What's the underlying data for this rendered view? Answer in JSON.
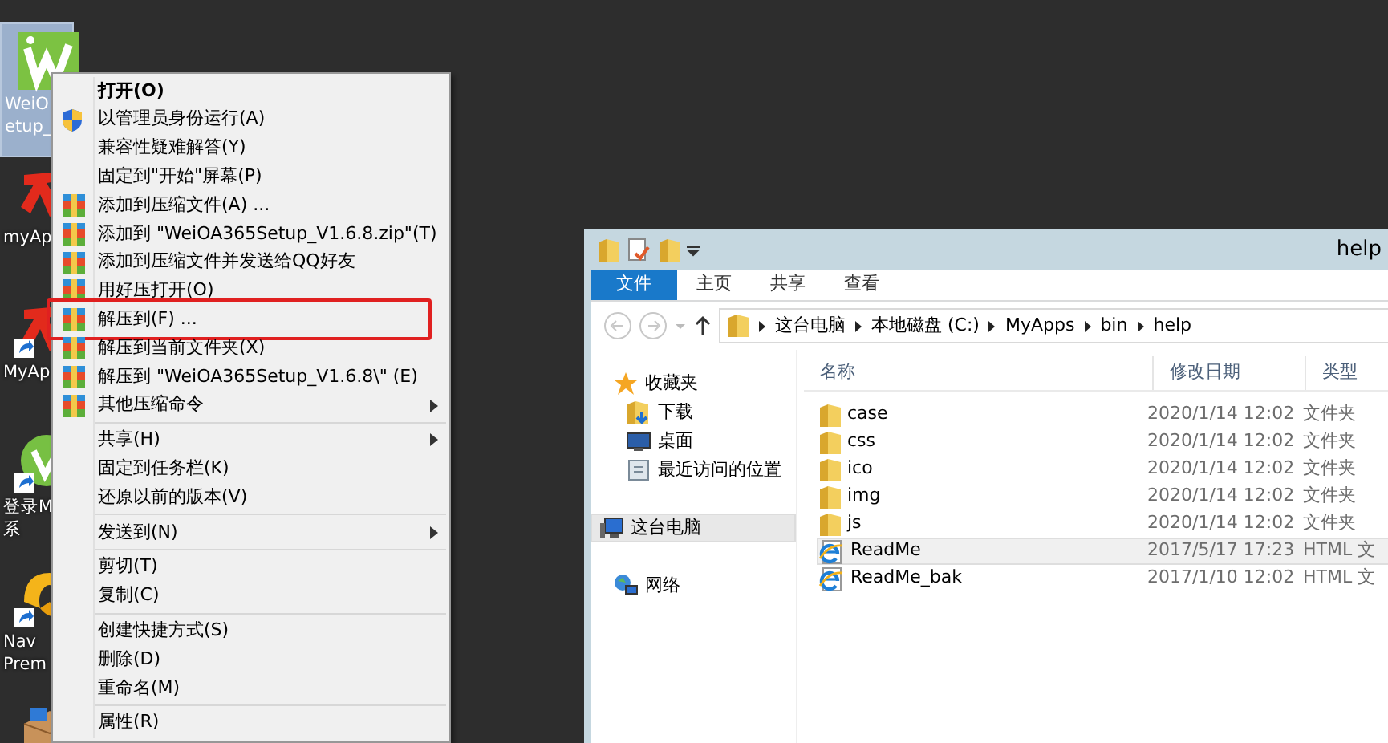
{
  "desktop_icons": [
    {
      "kind": "weioa",
      "labels": [
        "WeiO",
        "etup_"
      ],
      "selected": true,
      "shortcut": false
    },
    {
      "kind": "tianyi",
      "labels": [
        "myAp"
      ],
      "selected": false,
      "shortcut": false
    },
    {
      "kind": "tianyi",
      "labels": [
        "MyAp"
      ],
      "selected": false,
      "shortcut": true
    },
    {
      "kind": "login",
      "labels": [
        "登录M",
        "系"
      ],
      "selected": false,
      "shortcut": true
    },
    {
      "kind": "navicat",
      "labels": [
        "Nav",
        "Prem"
      ],
      "selected": false,
      "shortcut": true
    },
    {
      "kind": "package",
      "selected": false
    }
  ],
  "context_menu": {
    "items": [
      {
        "kind": "plain",
        "label": "打开(O)",
        "default": true,
        "submenu": false,
        "annotated": false
      },
      {
        "kind": "shield",
        "label": "以管理员身份运行(A)",
        "default": false,
        "submenu": false,
        "annotated": false
      },
      {
        "kind": "plain",
        "label": "兼容性疑难解答(Y)",
        "default": false,
        "submenu": false,
        "annotated": false
      },
      {
        "kind": "plain",
        "label": "固定到\"开始\"屏幕(P)",
        "default": false,
        "submenu": false,
        "annotated": false
      },
      {
        "kind": "archive",
        "label": "添加到压缩文件(A) ...",
        "default": false,
        "submenu": false,
        "annotated": false
      },
      {
        "kind": "archive",
        "label": "添加到 \"WeiOA365Setup_V1.6.8.zip\"(T)",
        "default": false,
        "submenu": false,
        "annotated": false
      },
      {
        "kind": "archive",
        "label": "添加到压缩文件并发送给QQ好友",
        "default": false,
        "submenu": false,
        "annotated": false
      },
      {
        "kind": "archive",
        "label": "用好压打开(O)",
        "default": false,
        "submenu": false,
        "annotated": false
      },
      {
        "kind": "archive",
        "label": "解压到(F) ...",
        "default": false,
        "submenu": false,
        "annotated": true
      },
      {
        "kind": "archive",
        "label": "解压到当前文件夹(X)",
        "default": false,
        "submenu": false,
        "annotated": false
      },
      {
        "kind": "archive",
        "label": "解压到 \"WeiOA365Setup_V1.6.8\\\" (E)",
        "default": false,
        "submenu": false,
        "annotated": false
      },
      {
        "kind": "archive",
        "label": "其他压缩命令",
        "default": false,
        "submenu": true,
        "annotated": false
      },
      {
        "kind": "separator"
      },
      {
        "kind": "plain",
        "label": "共享(H)",
        "default": false,
        "submenu": true,
        "annotated": false
      },
      {
        "kind": "plain",
        "label": "固定到任务栏(K)",
        "default": false,
        "submenu": false,
        "annotated": false
      },
      {
        "kind": "plain",
        "label": "还原以前的版本(V)",
        "default": false,
        "submenu": false,
        "annotated": false
      },
      {
        "kind": "separator"
      },
      {
        "kind": "plain",
        "label": "发送到(N)",
        "default": false,
        "submenu": true,
        "annotated": false
      },
      {
        "kind": "separator"
      },
      {
        "kind": "plain",
        "label": "剪切(T)",
        "default": false,
        "submenu": false,
        "annotated": false
      },
      {
        "kind": "plain",
        "label": "复制(C)",
        "default": false,
        "submenu": false,
        "annotated": false
      },
      {
        "kind": "separator"
      },
      {
        "kind": "plain",
        "label": "创建快捷方式(S)",
        "default": false,
        "submenu": false,
        "annotated": false
      },
      {
        "kind": "plain",
        "label": "删除(D)",
        "default": false,
        "submenu": false,
        "annotated": false
      },
      {
        "kind": "plain",
        "label": "重命名(M)",
        "default": false,
        "submenu": false,
        "annotated": false
      },
      {
        "kind": "separator"
      },
      {
        "kind": "plain",
        "label": "属性(R)",
        "default": false,
        "submenu": false,
        "annotated": false
      }
    ]
  },
  "explorer": {
    "title": "help",
    "tabs": [
      {
        "label": "文件",
        "selected": true
      },
      {
        "label": "主页",
        "selected": false
      },
      {
        "label": "共享",
        "selected": false
      },
      {
        "label": "查看",
        "selected": false
      }
    ],
    "breadcrumb": [
      "这台电脑",
      "本地磁盘 (C:)",
      "MyApps",
      "bin",
      "help"
    ],
    "nav_pane": [
      {
        "kind": "star",
        "label": "收藏夹",
        "selected": false,
        "children": [
          {
            "kind": "downloads",
            "label": "下载",
            "selected": false
          },
          {
            "kind": "desktop",
            "label": "桌面",
            "selected": false
          },
          {
            "kind": "recent",
            "label": "最近访问的位置",
            "selected": false
          }
        ]
      },
      {
        "kind": "computer",
        "label": "这台电脑",
        "selected": true
      },
      {
        "kind": "network",
        "label": "网络",
        "selected": false
      }
    ],
    "columns": [
      "名称",
      "修改日期",
      "类型"
    ],
    "files": [
      {
        "kind": "folder",
        "name": "case",
        "date": "2020/1/14 12:02",
        "type": "文件夹",
        "selected": false
      },
      {
        "kind": "folder",
        "name": "css",
        "date": "2020/1/14 12:02",
        "type": "文件夹",
        "selected": false
      },
      {
        "kind": "folder",
        "name": "ico",
        "date": "2020/1/14 12:02",
        "type": "文件夹",
        "selected": false
      },
      {
        "kind": "folder",
        "name": "img",
        "date": "2020/1/14 12:02",
        "type": "文件夹",
        "selected": false
      },
      {
        "kind": "folder",
        "name": "js",
        "date": "2020/1/14 12:02",
        "type": "文件夹",
        "selected": false
      },
      {
        "kind": "html",
        "name": "ReadMe",
        "date": "2017/5/17 17:23",
        "type": "HTML 文",
        "selected": true
      },
      {
        "kind": "html",
        "name": "ReadMe_bak",
        "date": "2017/1/10 12:02",
        "type": "HTML 文",
        "selected": false
      }
    ]
  }
}
